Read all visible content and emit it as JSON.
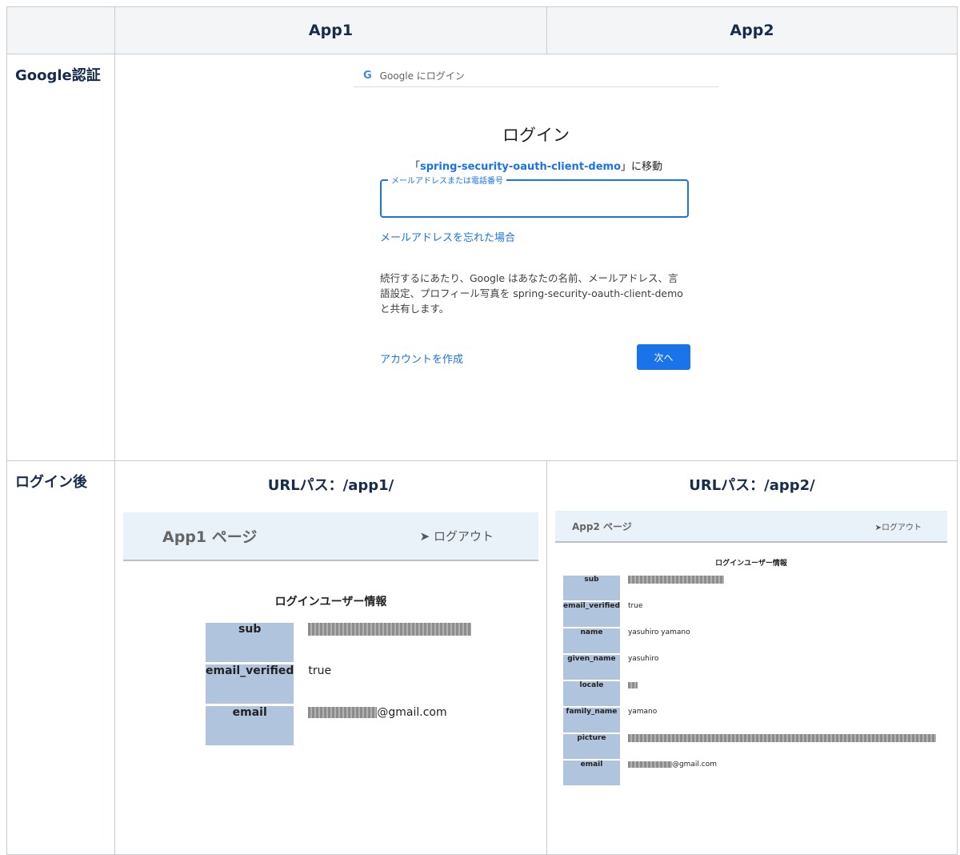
{
  "table": {
    "header_blank": "",
    "col1": "App1",
    "col2": "App2",
    "row1_label": "Google認証",
    "row2_label": "ログイン後"
  },
  "google_login": {
    "bar_label": "Google にログイン",
    "logo": "G",
    "title": "ログイン",
    "subtitle_prefix": "「",
    "subtitle_app": "spring-security-oauth-client-demo",
    "subtitle_suffix": "」に移動",
    "field_label": "メールアドレスまたは電話番号",
    "field_value": "",
    "forgot_link": "メールアドレスを忘れた場合",
    "notice_line1": "続行するにあたり、Google はあなたの名前、メールアドレス、言",
    "notice_line2": "語設定、プロフィール写真を spring-security-oauth-client-demo",
    "notice_line3": "と共有します。",
    "create_account": "アカウントを作成",
    "next_button": "次へ"
  },
  "app1": {
    "url_path": "URLパス：/app1/",
    "page_title": "App1 ページ",
    "logout": "ログアウト",
    "logout_icon": "sign-out-icon",
    "heading": "ログインユーザー情報",
    "rows": [
      {
        "key": "sub",
        "value": "",
        "redacted": true
      },
      {
        "key": "email_verified",
        "value": "true",
        "redacted": false
      },
      {
        "key": "email",
        "value": "@gmail.com",
        "redacted": true
      }
    ]
  },
  "app2": {
    "url_path": "URLパス：/app2/",
    "page_title": "App2 ページ",
    "logout": "ログアウト",
    "logout_icon": "sign-out-icon",
    "heading": "ログインユーザー情報",
    "rows": [
      {
        "key": "sub",
        "value": "",
        "redacted": true
      },
      {
        "key": "email_verified",
        "value": "true",
        "redacted": false
      },
      {
        "key": "name",
        "value": "yasuhiro yamano",
        "redacted": false
      },
      {
        "key": "given_name",
        "value": "yasuhiro",
        "redacted": false
      },
      {
        "key": "locale",
        "value": "",
        "redacted": true
      },
      {
        "key": "family_name",
        "value": "yamano",
        "redacted": false
      },
      {
        "key": "picture",
        "value": "",
        "redacted": true
      },
      {
        "key": "email",
        "value": "@gmail.com",
        "redacted": true
      }
    ]
  },
  "colors": {
    "header_bg": "#f4f5f7",
    "border": "#c8ccd1",
    "google_blue": "#1a73e8",
    "key_cell_bg": "#b0c4de",
    "app_header_bg": "#e9f1f9"
  }
}
